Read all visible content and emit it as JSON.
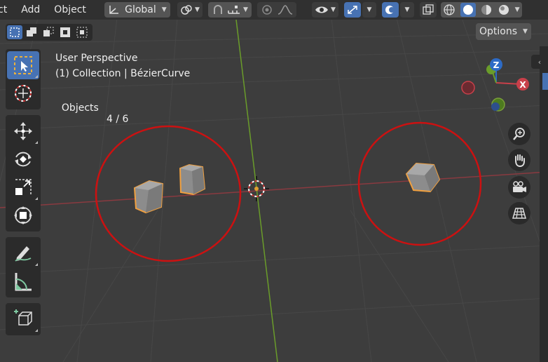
{
  "menu": {
    "item_1": "ct",
    "item_2": "Add",
    "item_3": "Object"
  },
  "header": {
    "transform_orientation": "Global",
    "options_label": "Options"
  },
  "overlay": {
    "view_name": "User Perspective",
    "collection_line": "(1) Collection | BézierCurve",
    "objects_label": "Objects",
    "objects_count": "4 / 6"
  },
  "gizmo": {
    "z_label": "Z",
    "x_label": "X"
  },
  "icons": {
    "tools": [
      "select-box-icon",
      "cursor-icon",
      "move-icon",
      "rotate-icon",
      "scale-icon",
      "transform-icon",
      "annotate-icon",
      "measure-icon",
      "add-cube-icon"
    ],
    "nav": [
      "zoom-icon",
      "hand-pan-icon",
      "camera-icon",
      "ortho-grid-icon"
    ]
  },
  "colors": {
    "accent": "#4772b3",
    "x_axis": "#c8404a",
    "y_axis": "#6a9c2a",
    "selection_outline": "#f0a040",
    "annotation": "#cc1111"
  }
}
